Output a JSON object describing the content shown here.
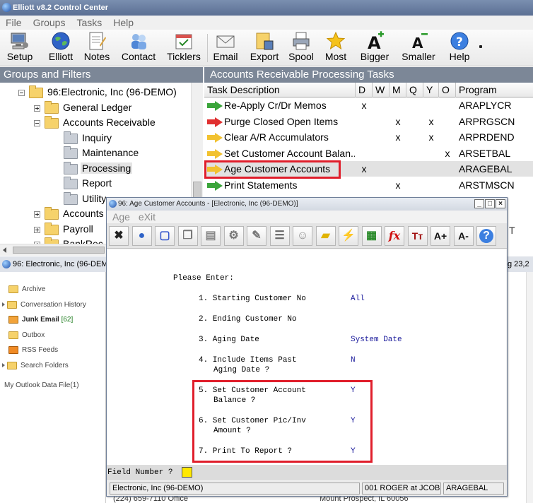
{
  "window": {
    "title": "Elliott v8.2 Control Center"
  },
  "menu": [
    "File",
    "Groups",
    "Tasks",
    "Help"
  ],
  "toolbar": {
    "buttons": [
      {
        "label": "Setup",
        "icon": "setup-computer-icon"
      },
      {
        "label": "Elliott",
        "icon": "globe-icon"
      },
      {
        "label": "Notes",
        "icon": "notes-icon"
      },
      {
        "label": "Contact",
        "icon": "contacts-icon"
      },
      {
        "label": "Ticklers",
        "icon": "calendar-icon"
      },
      {
        "label": "Email",
        "icon": "envelope-icon"
      },
      {
        "label": "Export",
        "icon": "export-icon"
      },
      {
        "label": "Spool",
        "icon": "printer-icon"
      },
      {
        "label": "Most",
        "icon": "star-icon"
      },
      {
        "label": "Bigger",
        "icon": "font-bigger-icon"
      },
      {
        "label": "Smaller",
        "icon": "font-smaller-icon"
      },
      {
        "label": "Help",
        "icon": "help-icon"
      }
    ]
  },
  "left_pane": {
    "header": "Groups and Filters",
    "tree": [
      {
        "label": "96:Electronic, Inc (96-DEMO)"
      },
      {
        "label": "General Ledger"
      },
      {
        "label": "Accounts Receivable"
      },
      {
        "label": "Inquiry"
      },
      {
        "label": "Maintenance"
      },
      {
        "label": "Processing"
      },
      {
        "label": "Report"
      },
      {
        "label": "Utility"
      },
      {
        "label": "Accounts"
      },
      {
        "label": "Payroll"
      },
      {
        "label": "BankRec"
      }
    ],
    "status": "96: Electronic, Inc (96-DEMO)"
  },
  "outlook_folders": [
    {
      "label": "Archive"
    },
    {
      "label": "Conversation History"
    },
    {
      "label": "Junk Email",
      "count": "[62]"
    },
    {
      "label": "Outbox"
    },
    {
      "label": "RSS Feeds"
    },
    {
      "label": "Search Folders"
    },
    {
      "label": "My Outlook Data File(1)"
    }
  ],
  "right_pane": {
    "header": "Accounts Receivable Processing Tasks",
    "columns": [
      "Task Description",
      "D",
      "W",
      "M",
      "Q",
      "Y",
      "O",
      "Program"
    ],
    "rows": [
      {
        "desc": "Re-Apply Cr/Dr Memos",
        "d": "x",
        "w": "",
        "m": "",
        "q": "",
        "y": "",
        "o": "",
        "program": "ARAPLYCR",
        "arrow": "green"
      },
      {
        "desc": "Purge Closed Open Items",
        "d": "",
        "w": "",
        "m": "x",
        "q": "",
        "y": "x",
        "o": "",
        "program": "ARPRGSCN",
        "arrow": "red"
      },
      {
        "desc": "Clear A/R Accumulators",
        "d": "",
        "w": "",
        "m": "x",
        "q": "",
        "y": "x",
        "o": "",
        "program": "ARPRDEND",
        "arrow": "yellow"
      },
      {
        "desc": "Set Customer Account Balan...",
        "d": "",
        "w": "",
        "m": "",
        "q": "",
        "y": "",
        "o": "x",
        "program": "ARSETBAL",
        "arrow": "yellow"
      },
      {
        "desc": "Age Customer Accounts",
        "d": "x",
        "w": "",
        "m": "",
        "q": "",
        "y": "",
        "o": "",
        "program": "ARAGEBAL",
        "arrow": "yellow"
      },
      {
        "desc": "Print Statements",
        "d": "",
        "w": "",
        "m": "x",
        "q": "",
        "y": "",
        "o": "",
        "program": "ARSTMSCN",
        "arrow": "green"
      }
    ],
    "status_fragment": "g 23,2",
    "behind_text_1": "T",
    "behind_text_2": "(224) 659-7110 Office",
    "behind_text_3": "Mount Prospect, IL 60056"
  },
  "dialog": {
    "title": "96: Age Customer Accounts - [Electronic, Inc (96-DEMO)]",
    "menu": [
      "Age",
      "eXit"
    ],
    "tools": [
      {
        "icon": "close-x-icon"
      },
      {
        "icon": "globe-icon"
      },
      {
        "icon": "select-icon"
      },
      {
        "icon": "copy-icon"
      },
      {
        "icon": "paste-icon"
      },
      {
        "icon": "settings-gear-icon"
      },
      {
        "icon": "edit-icon"
      },
      {
        "icon": "list-icon"
      },
      {
        "icon": "contacts-icon"
      },
      {
        "icon": "ruler-icon"
      },
      {
        "icon": "lightning-icon"
      },
      {
        "icon": "calendar-icon"
      },
      {
        "icon": "fx-icon"
      },
      {
        "icon": "font-size-icon"
      },
      {
        "icon": "font-bigger-icon"
      },
      {
        "icon": "font-smaller-icon"
      },
      {
        "icon": "help-icon"
      }
    ],
    "prompt": "Please Enter:",
    "fields": [
      {
        "line1": "1. Starting Customer No",
        "line2": "",
        "value": "All"
      },
      {
        "line1": "2. Ending Customer No",
        "line2": "",
        "value": ""
      },
      {
        "line1": "3. Aging Date",
        "line2": "",
        "value": "System Date"
      },
      {
        "line1": "4. Include Items Past",
        "line2": "Aging Date ?",
        "value": "N"
      },
      {
        "line1": "5. Set Customer Account",
        "line2": "Balance ?",
        "value": "Y"
      },
      {
        "line1": "6. Set Customer Pic/Inv",
        "line2": "Amount ?",
        "value": "Y"
      },
      {
        "line1": "7. Print To Report ?",
        "line2": "",
        "value": "Y"
      }
    ],
    "field_number_label": "Field Number ?",
    "status": {
      "company": "Electronic, Inc (96-DEMO)",
      "user": "001 ROGER at JCOB",
      "program": "ARAGEBAL"
    }
  },
  "colors": {
    "highlight_red": "#e01e2b",
    "pane_header": "#7c8797",
    "value_blue": "#1a1a9b"
  }
}
